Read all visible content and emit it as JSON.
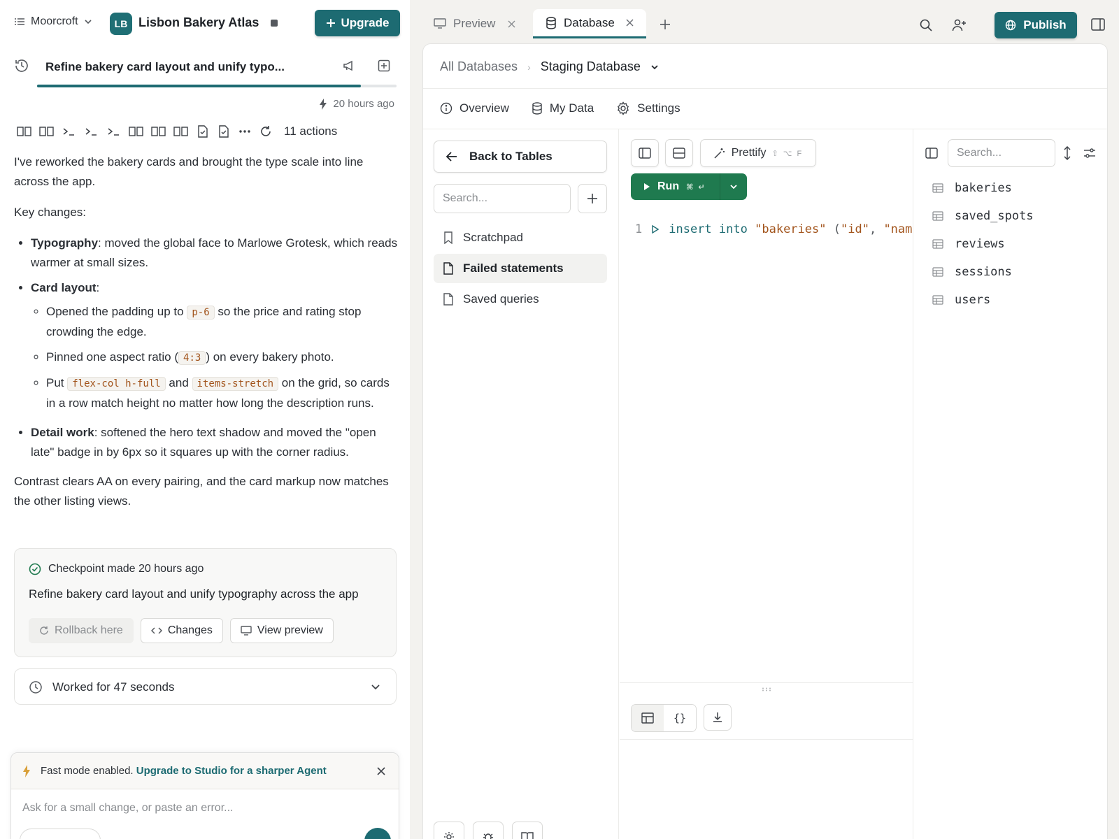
{
  "app": {
    "workspace": "Moorcroft",
    "project_initials": "LB",
    "project_name": "Lisbon Bakery Atlas",
    "upgrade_label": "Upgrade"
  },
  "thread": {
    "title": "Refine bakery card layout and unify typo...",
    "progress_fraction": 0.9,
    "timestamp": "20 hours ago",
    "actions_count": "11 actions"
  },
  "message": {
    "intro": "I've reworked the bakery cards and brought the type scale into line across the app.",
    "key_changes_label": "Key changes:",
    "typography_label": "Typography",
    "typography_text": ": moved the global face to Marlowe Grotesk, which reads warmer at small sizes.",
    "card_layout_label": "Card layout",
    "card_layout_colon": ":",
    "sub1_before": "Opened the padding up to ",
    "sub1_code": "p-6",
    "sub1_after": " so the price and rating stop crowding the edge.",
    "sub2_before": "Pinned one aspect ratio (",
    "sub2_code": "4:3",
    "sub2_after": ") on every bakery photo.",
    "sub3_before": "Put ",
    "sub3_code1": "flex-col h-full",
    "sub3_mid": " and ",
    "sub3_code2": "items-stretch",
    "sub3_after": " on the grid, so cards in a row match height no matter how long the description runs.",
    "detail_label": "Detail work",
    "detail_text": ": softened the hero text shadow and moved the \"open late\" badge in by 6px so it squares up with the corner radius.",
    "closing": "Contrast clears AA on every pairing, and the card markup now matches the other listing views."
  },
  "checkpoint": {
    "heading": "Checkpoint made 20 hours ago",
    "description": "Refine bakery card layout and unify typography across the app",
    "rollback_label": "Rollback here",
    "changes_label": "Changes",
    "view_preview_label": "View preview"
  },
  "worked": {
    "label": "Worked for 47 seconds"
  },
  "composer": {
    "fast_mode_text": "Fast mode enabled.",
    "upgrade_link": "Upgrade to Studio for a sharper Agent",
    "placeholder": "Ask for a small change, or paste an error..."
  },
  "tabs": {
    "preview": "Preview",
    "database": "Database",
    "publish_label": "Publish"
  },
  "database": {
    "breadcrumb_root": "All Databases",
    "breadcrumb_current": "Staging Database",
    "subnav": {
      "overview": "Overview",
      "my_data": "My Data",
      "settings": "Settings"
    },
    "back_label": "Back to Tables",
    "query_search_placeholder": "Search...",
    "query_items": [
      "Scratchpad",
      "Failed statements",
      "Saved queries"
    ],
    "active_query": "Failed statements",
    "prettify_label": "Prettify",
    "prettify_shortcut": "⇧ ⌥ F",
    "run_label": "Run",
    "run_shortcut": "⌘ ↵",
    "code": {
      "line_number": "1",
      "kw_insert": "insert",
      "kw_into": "into",
      "table": "\"bakeries\"",
      "paren_open": "(",
      "col1": "\"id\"",
      "comma": ",",
      "col2": "\"nam"
    },
    "json_toggle": "{}",
    "table_search_placeholder": "Search...",
    "tables": [
      "bakeries",
      "saved_spots",
      "reviews",
      "sessions",
      "users"
    ]
  },
  "colors": {
    "brand_teal": "#1d6b72",
    "run_green": "#1f7a4f",
    "code_string": "#a2541c"
  }
}
